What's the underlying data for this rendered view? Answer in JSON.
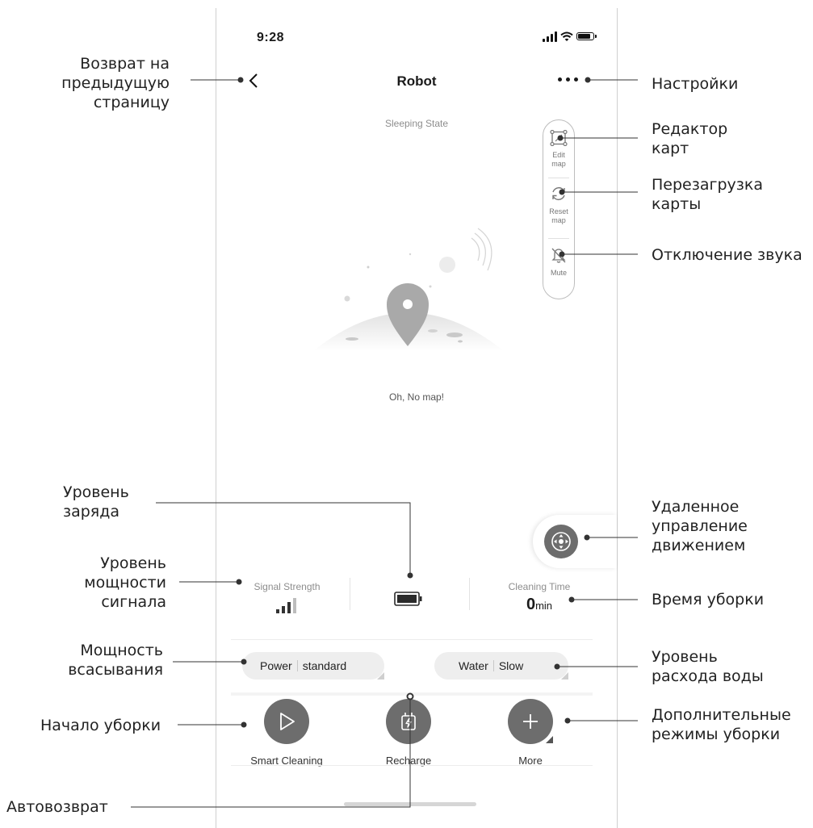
{
  "status_bar": {
    "time": "9:28"
  },
  "header": {
    "title": "Robot"
  },
  "state": "Sleeping State",
  "toolbar": {
    "edit_map": [
      "Edit",
      "map"
    ],
    "reset_map": [
      "Reset",
      "map"
    ],
    "mute": [
      "Mute"
    ]
  },
  "empty_state": {
    "message": "Oh, No map!"
  },
  "stats": {
    "signal_label": "Signal Strength",
    "time_label": "Cleaning Time",
    "time_value": "0",
    "time_unit": "min"
  },
  "pills": {
    "power_label": "Power",
    "power_value": "standard",
    "water_label": "Water",
    "water_value": "Slow"
  },
  "actions": {
    "smart_cleaning": "Smart Cleaning",
    "recharge": "Recharge",
    "more": "More"
  },
  "annotations": {
    "back": [
      "Возврат на",
      "предыдущую",
      "страницу"
    ],
    "settings": [
      "Настройки"
    ],
    "map_editor": [
      "Редактор",
      "карт"
    ],
    "reset_map": [
      "Перезагрузка",
      "карты"
    ],
    "mute": [
      "Отключение звука"
    ],
    "battery": [
      "Уровень",
      "заряда"
    ],
    "remote": [
      "Удаленное",
      "управление",
      "движением"
    ],
    "signal": [
      "Уровень",
      "мощности",
      "сигнала"
    ],
    "clean_time": [
      "Время уборки"
    ],
    "suction": [
      "Мощность",
      "всасывания"
    ],
    "water": [
      "Уровень",
      "расхода воды"
    ],
    "start": [
      "Начало уборки"
    ],
    "extra_modes": [
      "Дополнительные",
      "режимы уборки"
    ],
    "auto_return": [
      "Автовозврат"
    ]
  },
  "colors": {
    "accent": "#6d6d6d",
    "pill_bg": "#eeeeee",
    "muted_text": "#8d8d8d"
  },
  "icons": [
    "chevron-left-icon",
    "more-dots-icon",
    "edit-map-icon",
    "reset-map-icon",
    "mute-bell-icon",
    "dpad-icon",
    "signal-bars-icon",
    "battery-icon",
    "play-icon",
    "charge-icon",
    "plus-icon"
  ]
}
